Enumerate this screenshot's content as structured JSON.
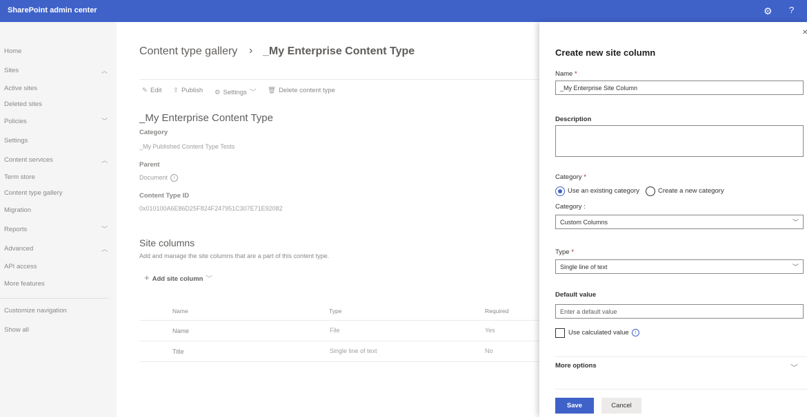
{
  "app": {
    "title": "SharePoint admin center",
    "settings_icon": "gear-icon",
    "help_label": "?"
  },
  "nav": {
    "items": [
      {
        "label": "Home",
        "chevron": ""
      },
      {
        "label": "Sites",
        "chevron": "︿"
      },
      {
        "label": "Active sites",
        "chevron": ""
      },
      {
        "label": "Deleted sites",
        "chevron": ""
      },
      {
        "label": "Policies",
        "chevron": "﹀"
      },
      {
        "label": "Settings",
        "chevron": ""
      },
      {
        "label": "Content services",
        "chevron": "︿"
      },
      {
        "label": "Term store",
        "chevron": ""
      },
      {
        "label": "Content type gallery",
        "chevron": ""
      },
      {
        "label": "Migration",
        "chevron": ""
      },
      {
        "label": "Reports",
        "chevron": "﹀"
      },
      {
        "label": "Advanced",
        "chevron": "︿"
      },
      {
        "label": "API access",
        "chevron": ""
      },
      {
        "label": "More features",
        "chevron": ""
      },
      {
        "label": "Customize navigation",
        "chevron": ""
      },
      {
        "label": "Show all",
        "chevron": ""
      }
    ]
  },
  "main": {
    "breadcrumb": {
      "parent": "Content type gallery",
      "separator": "›",
      "current": "_My Enterprise Content Type"
    },
    "commands": {
      "edit": "Edit",
      "publish": "Publish",
      "settings": "Settings",
      "delete": "Delete content type"
    },
    "content_type": {
      "title": "_My Enterprise Content Type",
      "category_label": "Category",
      "category_value": "_My Published Content Type Tests",
      "parent_label": "Parent",
      "parent_value": "Document",
      "id_label": "Content Type ID",
      "id_value": "0x010100A6E86D25F824F247951C307E71E92082"
    },
    "site_columns": {
      "title": "Site columns",
      "description": "Add and manage the site columns that are a part of this content type.",
      "add_label": "Add site column",
      "headers": {
        "name": "Name",
        "type": "Type",
        "required": "Required"
      },
      "rows": [
        {
          "name": "Name",
          "type": "File",
          "required": "Yes"
        },
        {
          "name": "Title",
          "type": "Single line of text",
          "required": "No"
        }
      ]
    }
  },
  "panel": {
    "title": "Create new site column",
    "name_label": "Name",
    "required_mark": "*",
    "name_value": "_My Enterprise Site Column",
    "description_label": "Description",
    "category_label": "Category",
    "category_options": {
      "existing": "Use an existing category",
      "new": "Create a new category"
    },
    "category_select_label": "Category :",
    "category_select_value": "Custom Columns",
    "type_label": "Type",
    "type_value": "Single line of text",
    "default_value_label": "Default value",
    "default_value_placeholder": "Enter a default value",
    "calculated_label": "Use calculated value",
    "more_options_label": "More options",
    "save_label": "Save",
    "cancel_label": "Cancel"
  }
}
